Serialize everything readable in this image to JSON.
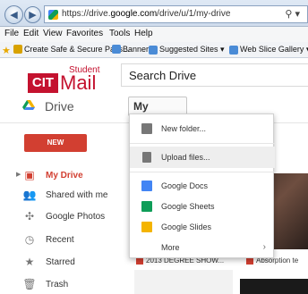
{
  "browser": {
    "url_prefix": "https://drive.",
    "url_domain": "google.com",
    "url_path": "/drive/u/1/my-drive",
    "search_glyph": "⚲ ▾",
    "back_glyph": "◀",
    "forward_glyph": "▶"
  },
  "menu": [
    "File",
    "Edit",
    "View",
    "Favorites",
    "Tools",
    "Help"
  ],
  "favorites": [
    {
      "label": "Create Safe & Secure Pass...",
      "icon": "shield-icon",
      "color": "#d8a200"
    },
    {
      "label": "Banner",
      "icon": "page-icon",
      "color": "#4a8bd6"
    },
    {
      "label": "Suggested Sites ▾",
      "icon": "page-icon",
      "color": "#4a8bd6"
    },
    {
      "label": "Web Slice Gallery ▾",
      "icon": "page-icon",
      "color": "#4a8bd6"
    }
  ],
  "logo": {
    "student": "Student",
    "cit": "CIT",
    "mail": "Mail"
  },
  "search": {
    "placeholder": "Search Drive"
  },
  "app": {
    "title": "Drive",
    "my_drive_button": "My Drive",
    "caret": "▼"
  },
  "sidebar": {
    "new_label": "NEW",
    "items": [
      {
        "label": "My Drive",
        "icon": "folder-icon",
        "glyph": "▣",
        "active": true
      },
      {
        "label": "Shared with me",
        "icon": "people-icon",
        "glyph": "👥",
        "active": false
      },
      {
        "label": "Google Photos",
        "icon": "pinwheel-icon",
        "glyph": "✣",
        "active": false
      },
      {
        "label": "Recent",
        "icon": "clock-icon",
        "glyph": "◷",
        "active": false
      },
      {
        "label": "Starred",
        "icon": "star-icon",
        "glyph": "★",
        "active": false
      },
      {
        "label": "Trash",
        "icon": "trash-icon",
        "glyph": "🗑",
        "active": false
      }
    ]
  },
  "dropdown": {
    "items": [
      {
        "label": "New folder...",
        "icon": "new-folder-icon",
        "color": "#777777"
      },
      {
        "label": "Upload files...",
        "icon": "upload-files-icon",
        "color": "#777777"
      },
      {
        "label": "Google Docs",
        "icon": "google-docs-icon",
        "color": "#4285f4"
      },
      {
        "label": "Google Sheets",
        "icon": "google-sheets-icon",
        "color": "#0f9d58"
      },
      {
        "label": "Google Slides",
        "icon": "google-slides-icon",
        "color": "#f4b400"
      },
      {
        "label": "More",
        "icon": "",
        "color": ""
      }
    ],
    "more_arrow": "›"
  },
  "files": [
    {
      "label": "2013 DEGREE SHOW...",
      "icon": "image-file-icon",
      "color": "#d23f31"
    },
    {
      "label": "Absorption te",
      "icon": "image-file-icon",
      "color": "#d23f31"
    }
  ]
}
